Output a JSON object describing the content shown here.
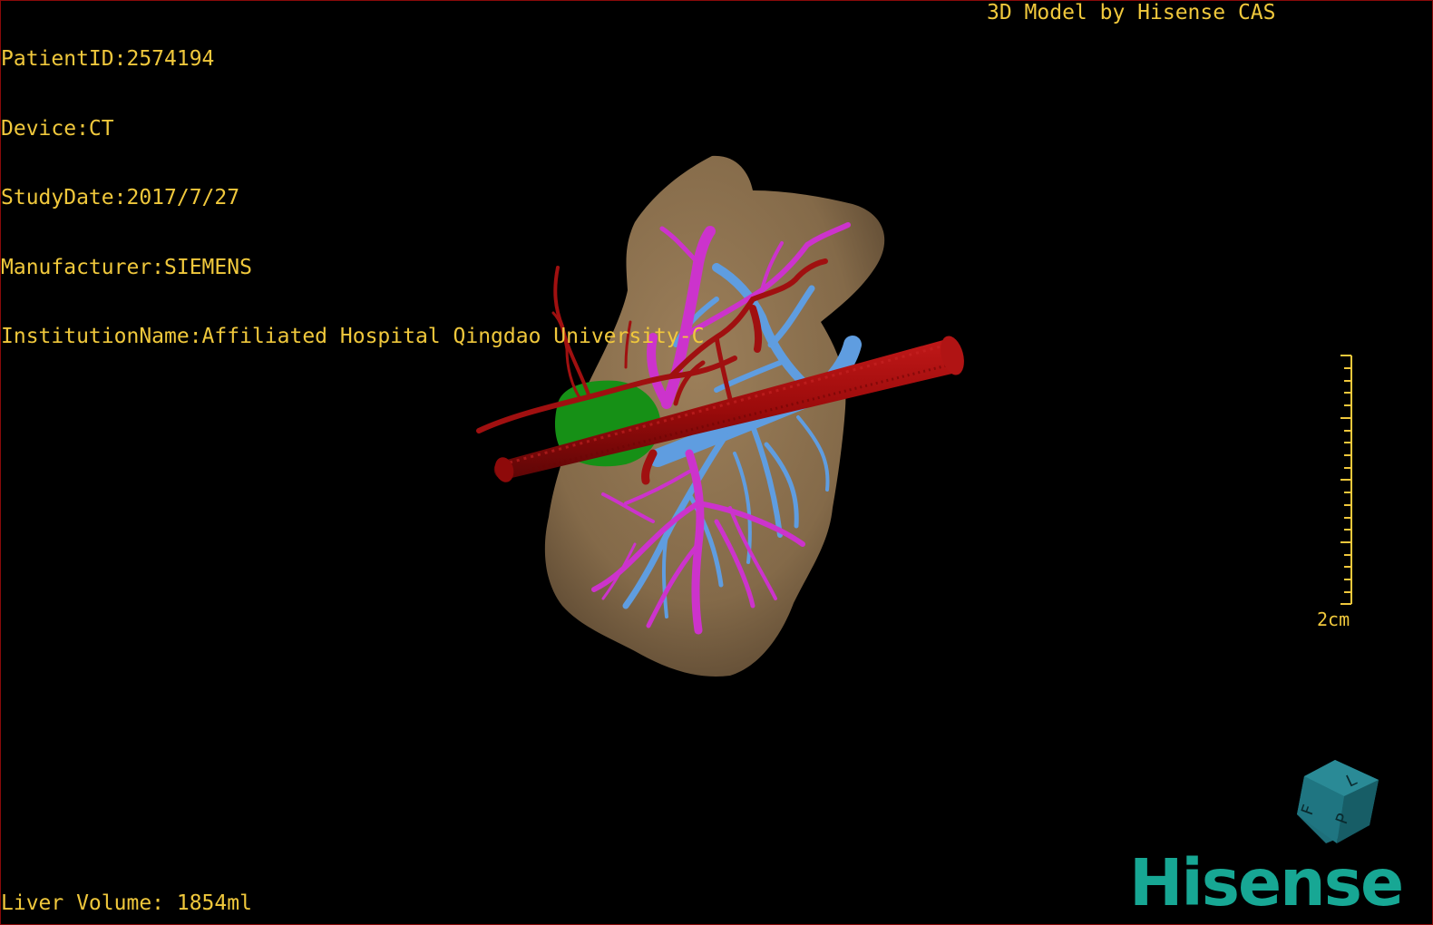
{
  "window": {
    "title": "3D Model by Hisense CAS"
  },
  "patient_info": {
    "patient_id": "PatientID:2574194",
    "device": "Device:CT",
    "study_date": "StudyDate:2017/7/27",
    "manufacturer": "Manufacturer:SIEMENS",
    "institution": "InstitutionName:Affiliated Hospital Qingdao University-C"
  },
  "measurements": {
    "liver_volume": "Liver Volume: 1854ml"
  },
  "scale_bar": {
    "label": "2cm"
  },
  "orientation_cube": {
    "face_labels": [
      "F",
      "L",
      "P"
    ]
  },
  "brand": {
    "logo_text": "Hisense"
  },
  "colors": {
    "overlay_text": "#f0c83c",
    "liver": "#8a6e4b",
    "artery": "#a40d0d",
    "portal_vein": "#cc33cc",
    "hepatic_vein": "#5f9de0",
    "gallbladder": "#1a8a1a",
    "brand": "#17a794",
    "border": "#8a0a0a"
  }
}
